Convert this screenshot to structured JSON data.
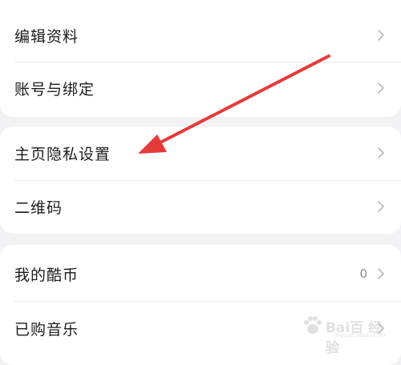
{
  "groups": [
    {
      "items": [
        {
          "label": "编辑资料"
        },
        {
          "label": "账号与绑定"
        }
      ]
    },
    {
      "items": [
        {
          "label": "主页隐私设置"
        },
        {
          "label": "二维码"
        }
      ]
    },
    {
      "items": [
        {
          "label": "我的酷币",
          "value": "0"
        },
        {
          "label": "已购音乐"
        }
      ]
    }
  ],
  "colors": {
    "background": "#f2f2f4",
    "card": "#ffffff",
    "text": "#1c1c1e",
    "chevron": "#b9b9be",
    "annotation_arrow": "#e53a3a"
  },
  "watermark": {
    "text": "Bai百 经验",
    "sub": "jingyan.baidu.com"
  }
}
